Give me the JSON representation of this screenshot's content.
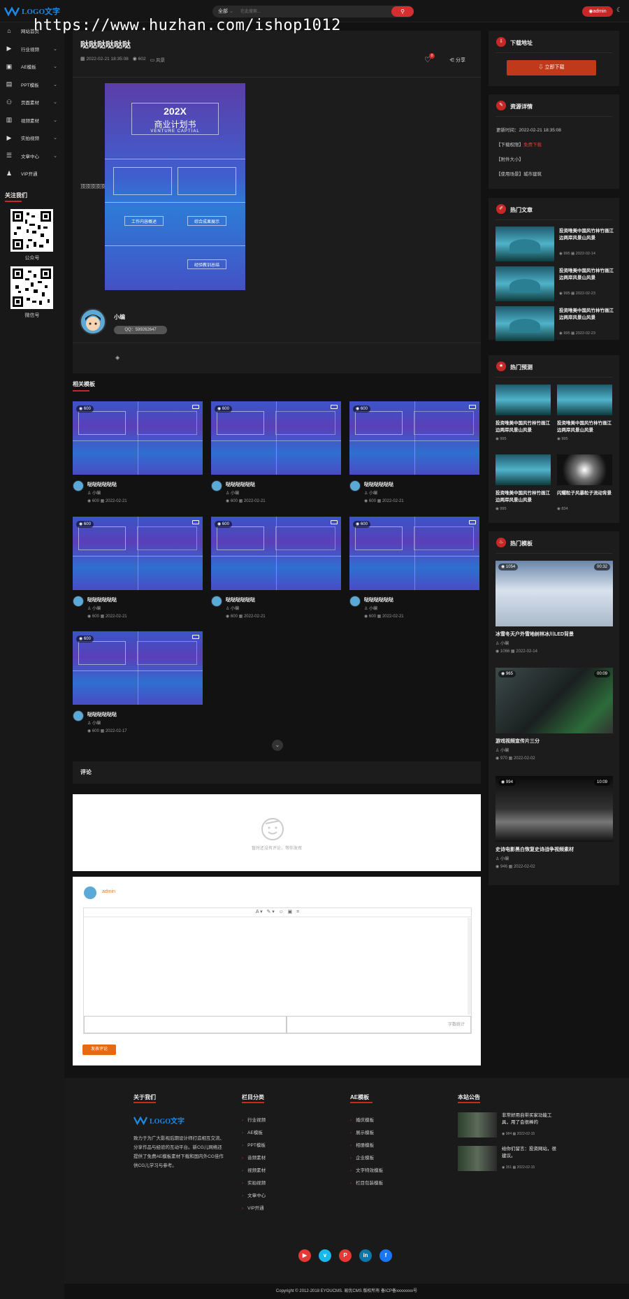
{
  "header": {
    "logo_text": "LOGO文字",
    "search_category": "全部",
    "search_placeholder": "在此搜索...",
    "admin_label": "admin"
  },
  "watermark": "https://www.huzhan.com/ishop1012",
  "sidebar": {
    "items": [
      {
        "label": "网站首页",
        "icon": "home-icon",
        "has_chevron": false
      },
      {
        "label": "行业视频",
        "icon": "play-circle-icon",
        "has_chevron": true
      },
      {
        "label": "AE模板",
        "icon": "video-icon",
        "has_chevron": true
      },
      {
        "label": "PPT模板",
        "icon": "briefcase-icon",
        "has_chevron": true
      },
      {
        "label": "页面素材",
        "icon": "people-icon",
        "has_chevron": true
      },
      {
        "label": "视频素材",
        "icon": "book-icon",
        "has_chevron": true
      },
      {
        "label": "实拍视频",
        "icon": "film-icon",
        "has_chevron": true
      },
      {
        "label": "文章中心",
        "icon": "document-icon",
        "has_chevron": true
      },
      {
        "label": "VIP开通",
        "icon": "user-icon",
        "has_chevron": false
      }
    ],
    "follow_title": "关注我们",
    "qr": [
      {
        "label": "公众号"
      },
      {
        "label": "微信号"
      }
    ]
  },
  "article": {
    "title": "哒哒哒哒哒哒",
    "date": "2022-02-21 18:35:08",
    "views": "602",
    "category": "风景",
    "like_count": "0",
    "share_label": "分享",
    "side_text": "顶顶顶顶顶",
    "image_title_en": "202X",
    "image_title_cn": "商业计划书",
    "image_subtitle": "VENTURE CAPTIAL",
    "image_sections": [
      "工作内容概述",
      "综合成果展示",
      "经验教训总结"
    ],
    "author_name": "小编",
    "author_qq": "QQ：599262647"
  },
  "related": {
    "title": "相关模板",
    "items": [
      {
        "views": "600",
        "name": "哒哒哒哒哒哒",
        "author": "小编",
        "date": "2022-02-21"
      },
      {
        "views": "600",
        "name": "哒哒哒哒哒哒",
        "author": "小编",
        "date": "2022-02-21"
      },
      {
        "views": "600",
        "name": "哒哒哒哒哒哒",
        "author": "小编",
        "date": "2022-02-21"
      },
      {
        "views": "600",
        "name": "哒哒哒哒哒哒",
        "author": "小编",
        "date": "2022-02-21"
      },
      {
        "views": "600",
        "name": "哒哒哒哒哒哒",
        "author": "小编",
        "date": "2022-02-21"
      },
      {
        "views": "600",
        "name": "哒哒哒哒哒哒",
        "author": "小编",
        "date": "2022-02-21"
      },
      {
        "views": "600",
        "name": "哒哒哒哒哒哒",
        "author": "小编",
        "date": "2022-02-17"
      }
    ]
  },
  "comments": {
    "title": "评论",
    "empty_text": "暂时还没有评论，等你发挥",
    "user": "admin",
    "footer_right": "字数统计",
    "submit_label": "发表评论"
  },
  "right": {
    "download": {
      "title": "下载地址",
      "button": "立即下载"
    },
    "details": {
      "title": "资源详情",
      "lines": [
        "更新时间：2022-02-21 18:35:08",
        "【下载权限】",
        "【附件大小】",
        "【使用场景】城市建筑"
      ],
      "download_perm_value": "免费下载"
    },
    "hot_articles": {
      "title": "热门文章",
      "items": [
        {
          "title": "投资唯美中国风竹林竹画江边两岸风景山风景",
          "views": "995",
          "date": "2022-02-14"
        },
        {
          "title": "投资唯美中国风竹林竹画江边两岸风景山风景",
          "views": "995",
          "date": "2022-02-23"
        },
        {
          "title": "投资唯美中国风竹林竹画江边两岸风景山风景",
          "views": "995",
          "date": "2022-02-23"
        }
      ]
    },
    "hot_predictions": {
      "title": "热门预测",
      "items": [
        {
          "title": "投资唯美中国风竹林竹画江边两岸风景山风景",
          "views": "995"
        },
        {
          "title": "投资唯美中国风竹林竹画江边两岸风景山风景",
          "views": "995"
        },
        {
          "title": "投资唯美中国风竹林竹画江边两岸风景山风景",
          "views": "995"
        },
        {
          "title": "闪耀粒子风暴粒子流动背景",
          "views": "834"
        }
      ]
    },
    "hot_templates": {
      "title": "热门模板",
      "items": [
        {
          "views": "1054",
          "duration": "00:32",
          "title": "冰雪冬天户外雪地树林冰川LED背景",
          "author": "小编",
          "stat_views": "1066",
          "date": "2022-02-14"
        },
        {
          "views": "965",
          "duration": "00:09",
          "title": "游戏视频宣传片三分",
          "author": "小编",
          "stat_views": "970",
          "date": "2022-02-02"
        },
        {
          "views": "994",
          "duration": "10:09",
          "title": "史诗电影黑白恢复史诗战争视频素材",
          "author": "小编",
          "stat_views": "946",
          "date": "2022-02-02"
        }
      ]
    }
  },
  "footer": {
    "about_title": "关于我们",
    "about_logo": "LOGO文字",
    "about_text": "致力于为广大影视后期设计师打造相互交流、分享作品与经验的互动平台。新CG儿网络还提供了免费AE模板素材下载和国内外CG佳作供CG儿学习与参考。",
    "columns": [
      {
        "title": "栏目分类",
        "links": [
          "行业视频",
          "AE模板",
          "PPT模板",
          "音频素材",
          "视频素材",
          "实拍视频",
          "文章中心",
          "VIP开通"
        ]
      },
      {
        "title": "AE模板",
        "links": [
          "婚庆模板",
          "展示模板",
          "相册模板",
          "企业模板",
          "文字特效模板",
          "栏目包装模板"
        ]
      }
    ],
    "notice_title": "本站公告",
    "notices": [
      {
        "title": "非常好用自带买家功能工具，用了会很棒的",
        "views": "984",
        "date": "2022-02-15"
      },
      {
        "title": "给你们留言：投资网站，很建议。",
        "views": "351",
        "date": "2022-02-15"
      }
    ],
    "social": [
      {
        "icon": "youtube-icon",
        "glyph": "▶",
        "color": "#e53935"
      },
      {
        "icon": "vimeo-icon",
        "glyph": "v",
        "color": "#1ab7ea"
      },
      {
        "icon": "pinterest-icon",
        "glyph": "P",
        "color": "#e53935"
      },
      {
        "icon": "linkedin-icon",
        "glyph": "in",
        "color": "#0e76a8"
      },
      {
        "icon": "facebook-icon",
        "glyph": "f",
        "color": "#1877f2"
      }
    ],
    "copyright": "Copyright © 2012-2018 EYOUCMS. 易优CMS 版权所有 备ICP备xxxxxxxx号"
  },
  "colors": {
    "accent": "#c62828",
    "background": "#121212",
    "card": "#1c1c1c",
    "submit": "#e66a12"
  }
}
